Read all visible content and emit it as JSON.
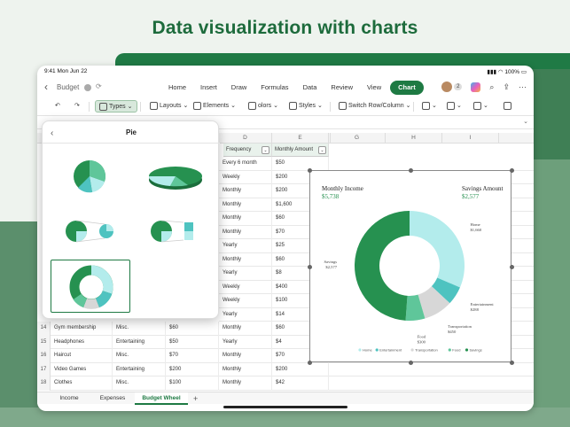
{
  "headline": "Data visualization with charts",
  "status": {
    "time": "9:41  Mon Jun 22",
    "battery": "100%"
  },
  "nav": {
    "doc_title": "Budget",
    "tabs": [
      "Home",
      "Insert",
      "Draw",
      "Formulas",
      "Data",
      "Review",
      "View",
      "Chart"
    ],
    "active_tab": "Chart",
    "collab_count": "2"
  },
  "toolbar": {
    "types": "Types",
    "layouts": "Layouts",
    "elements": "Elements",
    "colors": "olors",
    "styles": "Styles",
    "switch": "Switch Row/Column"
  },
  "panel": {
    "title": "Pie"
  },
  "grid": {
    "columns": [
      "D",
      "E",
      "F",
      "G",
      "H",
      "I"
    ],
    "headers": {
      "frequency": "Frequency",
      "monthly_amount": "Monthly Amount"
    },
    "right_rows": [
      {
        "freq": "Every 6 month",
        "amt": "$50"
      },
      {
        "freq": "Weekly",
        "amt": "$200"
      },
      {
        "freq": "Monthly",
        "amt": "$200"
      },
      {
        "freq": "Monthly",
        "amt": "$1,600"
      },
      {
        "freq": "Monthly",
        "amt": "$60"
      },
      {
        "freq": "Monthly",
        "amt": "$70"
      },
      {
        "freq": "Yearly",
        "amt": "$25"
      },
      {
        "freq": "Monthly",
        "amt": "$60"
      },
      {
        "freq": "Yearly",
        "amt": "$8"
      },
      {
        "freq": "Weekly",
        "amt": "$400"
      },
      {
        "freq": "Weekly",
        "amt": "$100"
      },
      {
        "freq": "Yearly",
        "amt": "$14"
      }
    ],
    "full_rows": [
      {
        "n": "14",
        "item": "Gym membership",
        "cat": "Misc.",
        "cost": "$60",
        "freq": "Monthly",
        "amt": "$60"
      },
      {
        "n": "15",
        "item": "Headphones",
        "cat": "Entertaining",
        "cost": "$50",
        "freq": "Yearly",
        "amt": "$4"
      },
      {
        "n": "16",
        "item": "Haircut",
        "cat": "Misc.",
        "cost": "$70",
        "freq": "Monthly",
        "amt": "$70"
      },
      {
        "n": "17",
        "item": "Video Games",
        "cat": "Entertaining",
        "cost": "$200",
        "freq": "Monthly",
        "amt": "$200"
      },
      {
        "n": "18",
        "item": "Clothes",
        "cat": "Misc.",
        "cost": "$100",
        "freq": "Monthly",
        "amt": "$42"
      }
    ]
  },
  "chart_data": {
    "type": "pie",
    "variant": "donut",
    "labels": [
      "Home",
      "Entertainment",
      "Transportation",
      "Food",
      "Savings"
    ],
    "values": [
      1660,
      288,
      450,
      300,
      2577
    ],
    "value_labels": [
      "$1,660",
      "$288",
      "$450",
      "$300",
      "$2,577"
    ],
    "colors": [
      "#b3ecec",
      "#4ec3c0",
      "#d7d7d7",
      "#5fc69a",
      "#269150"
    ],
    "header_left_label": "Monthly Income",
    "header_left_value": "$5,738",
    "header_right_label": "Savings Amount",
    "header_right_value": "$2,577",
    "legend_position": "bottom"
  },
  "sheets": [
    "Income",
    "Expenses",
    "Budget Wheel"
  ],
  "active_sheet": "Budget Wheel"
}
